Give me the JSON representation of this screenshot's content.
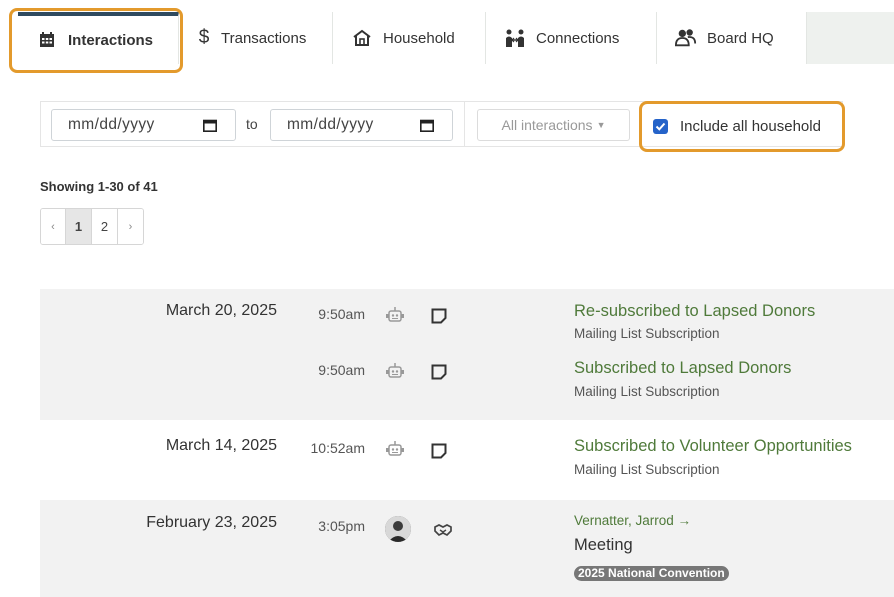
{
  "tabs": [
    {
      "label": "Interactions",
      "icon": "calendar-icon",
      "active": true
    },
    {
      "label": "Transactions",
      "icon": "dollar-icon"
    },
    {
      "label": "Household",
      "icon": "home-icon"
    },
    {
      "label": "Connections",
      "icon": "connections-icon"
    },
    {
      "label": "Board HQ",
      "icon": "users-icon"
    }
  ],
  "filters": {
    "date_from_placeholder": "mm/dd/yyyy",
    "to_label": "to",
    "date_to_placeholder": "mm/dd/yyyy",
    "type_select": "All interactions",
    "include_household_label": "Include all household",
    "include_household_checked": true
  },
  "showing": "Showing 1-30 of 41",
  "pagination": {
    "prev": "‹",
    "pages": [
      "1",
      "2"
    ],
    "current": "1",
    "next": "›"
  },
  "interactions": [
    {
      "date": "March 20, 2025",
      "time": "9:50am",
      "title": "Re-subscribed to Lapsed Donors",
      "subtitle": "Mailing List Subscription"
    },
    {
      "date": "",
      "time": "9:50am",
      "title": "Subscribed to Lapsed Donors",
      "subtitle": "Mailing List Subscription"
    },
    {
      "date": "March 14, 2025",
      "time": "10:52am",
      "title": "Subscribed to Volunteer Opportunities",
      "subtitle": "Mailing List Subscription"
    },
    {
      "date": "February 23, 2025",
      "time": "3:05pm",
      "person": "Vernatter, Jarrod →",
      "title": "Meeting",
      "tag": "2025 National Convention"
    }
  ],
  "colors": {
    "accent_green": "#4f7a3a",
    "highlight_orange": "#e39a2c",
    "checkbox_blue": "#2563c9"
  }
}
